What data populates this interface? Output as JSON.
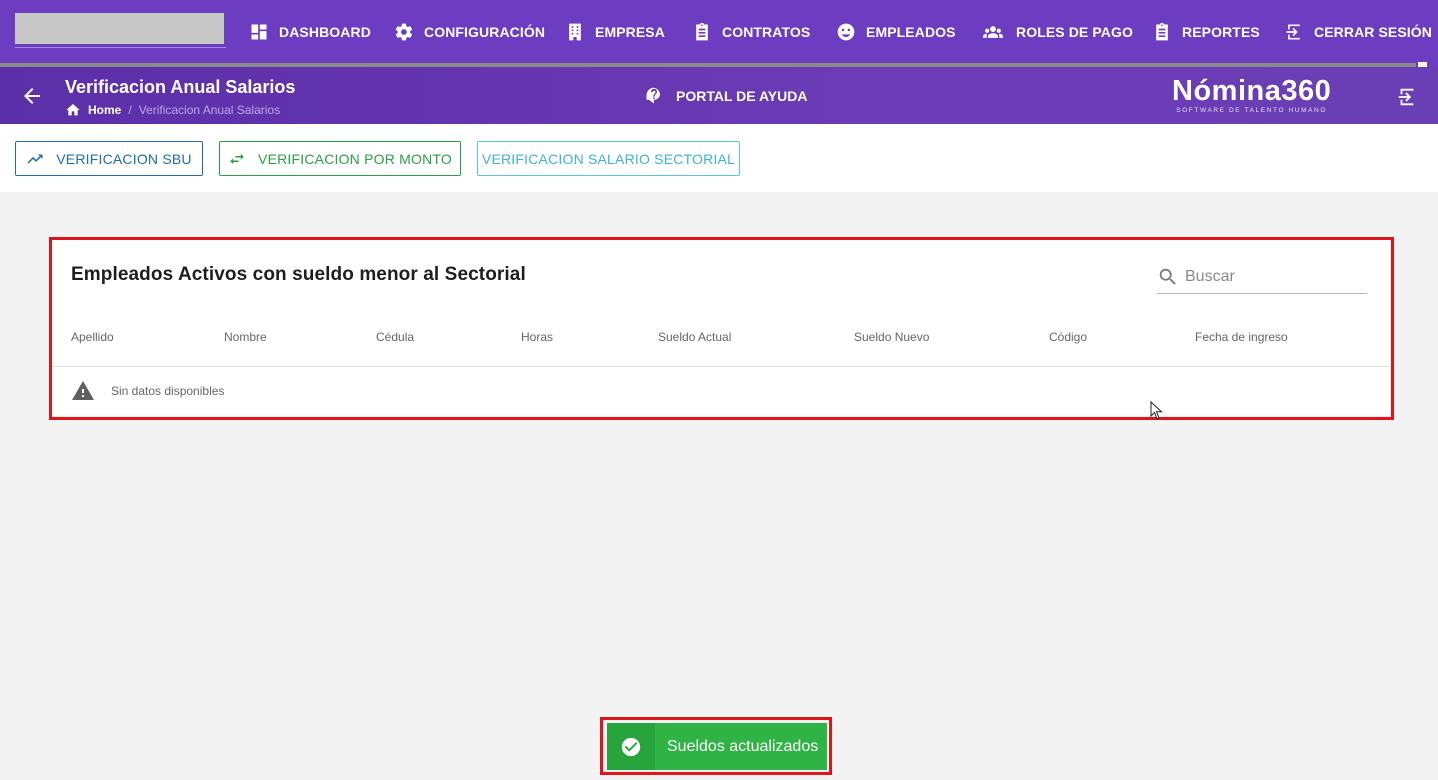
{
  "nav": {
    "items": [
      {
        "label": "DASHBOARD",
        "icon": "dashboard-icon"
      },
      {
        "label": "CONFIGURACIÓN",
        "icon": "gear-icon"
      },
      {
        "label": "EMPRESA",
        "icon": "building-icon"
      },
      {
        "label": "CONTRATOS",
        "icon": "clipboard-icon"
      },
      {
        "label": "EMPLEADOS",
        "icon": "face-icon"
      },
      {
        "label": "ROLES DE PAGO",
        "icon": "users-icon"
      },
      {
        "label": "REPORTES",
        "icon": "clipboard-icon"
      },
      {
        "label": "CERRAR SESIÓN",
        "icon": "logout-icon"
      }
    ],
    "progress_fraction": 0.985
  },
  "header": {
    "title": "Verificacion Anual Salarios",
    "breadcrumb_home": "Home",
    "breadcrumb_separator": "/",
    "breadcrumb_current": "Verificacion Anual Salarios",
    "help_label": "PORTAL DE AYUDA",
    "brand_name": "Nómina360",
    "brand_tagline": "SOFTWARE DE TALENTO HUMANO"
  },
  "tabs": [
    {
      "label": "VERIFICACION SBU",
      "icon": "trending-up-icon"
    },
    {
      "label": "VERIFICACION POR MONTO",
      "icon": "swap-arrows-icon"
    },
    {
      "label": "VERIFICACION SALARIO SECTORIAL"
    }
  ],
  "table": {
    "title": "Empleados Activos con sueldo menor al Sectorial",
    "search_placeholder": "Buscar",
    "columns": [
      "Apellido",
      "Nombre",
      "Cédula",
      "Horas",
      "Sueldo Actual",
      "Sueldo Nuevo",
      "Código",
      "Fecha de ingreso"
    ],
    "empty_text": "Sin datos disponibles"
  },
  "toast": {
    "message": "Sueldos actualizados"
  },
  "colors": {
    "nav_bg": "#6c3dc0",
    "sbu_blue": "#1e6bb0",
    "monto_green": "#2aa046",
    "sectorial_cyan": "#3cb2d6",
    "toast_green": "#2fb344",
    "highlight_red": "#e1141e"
  }
}
